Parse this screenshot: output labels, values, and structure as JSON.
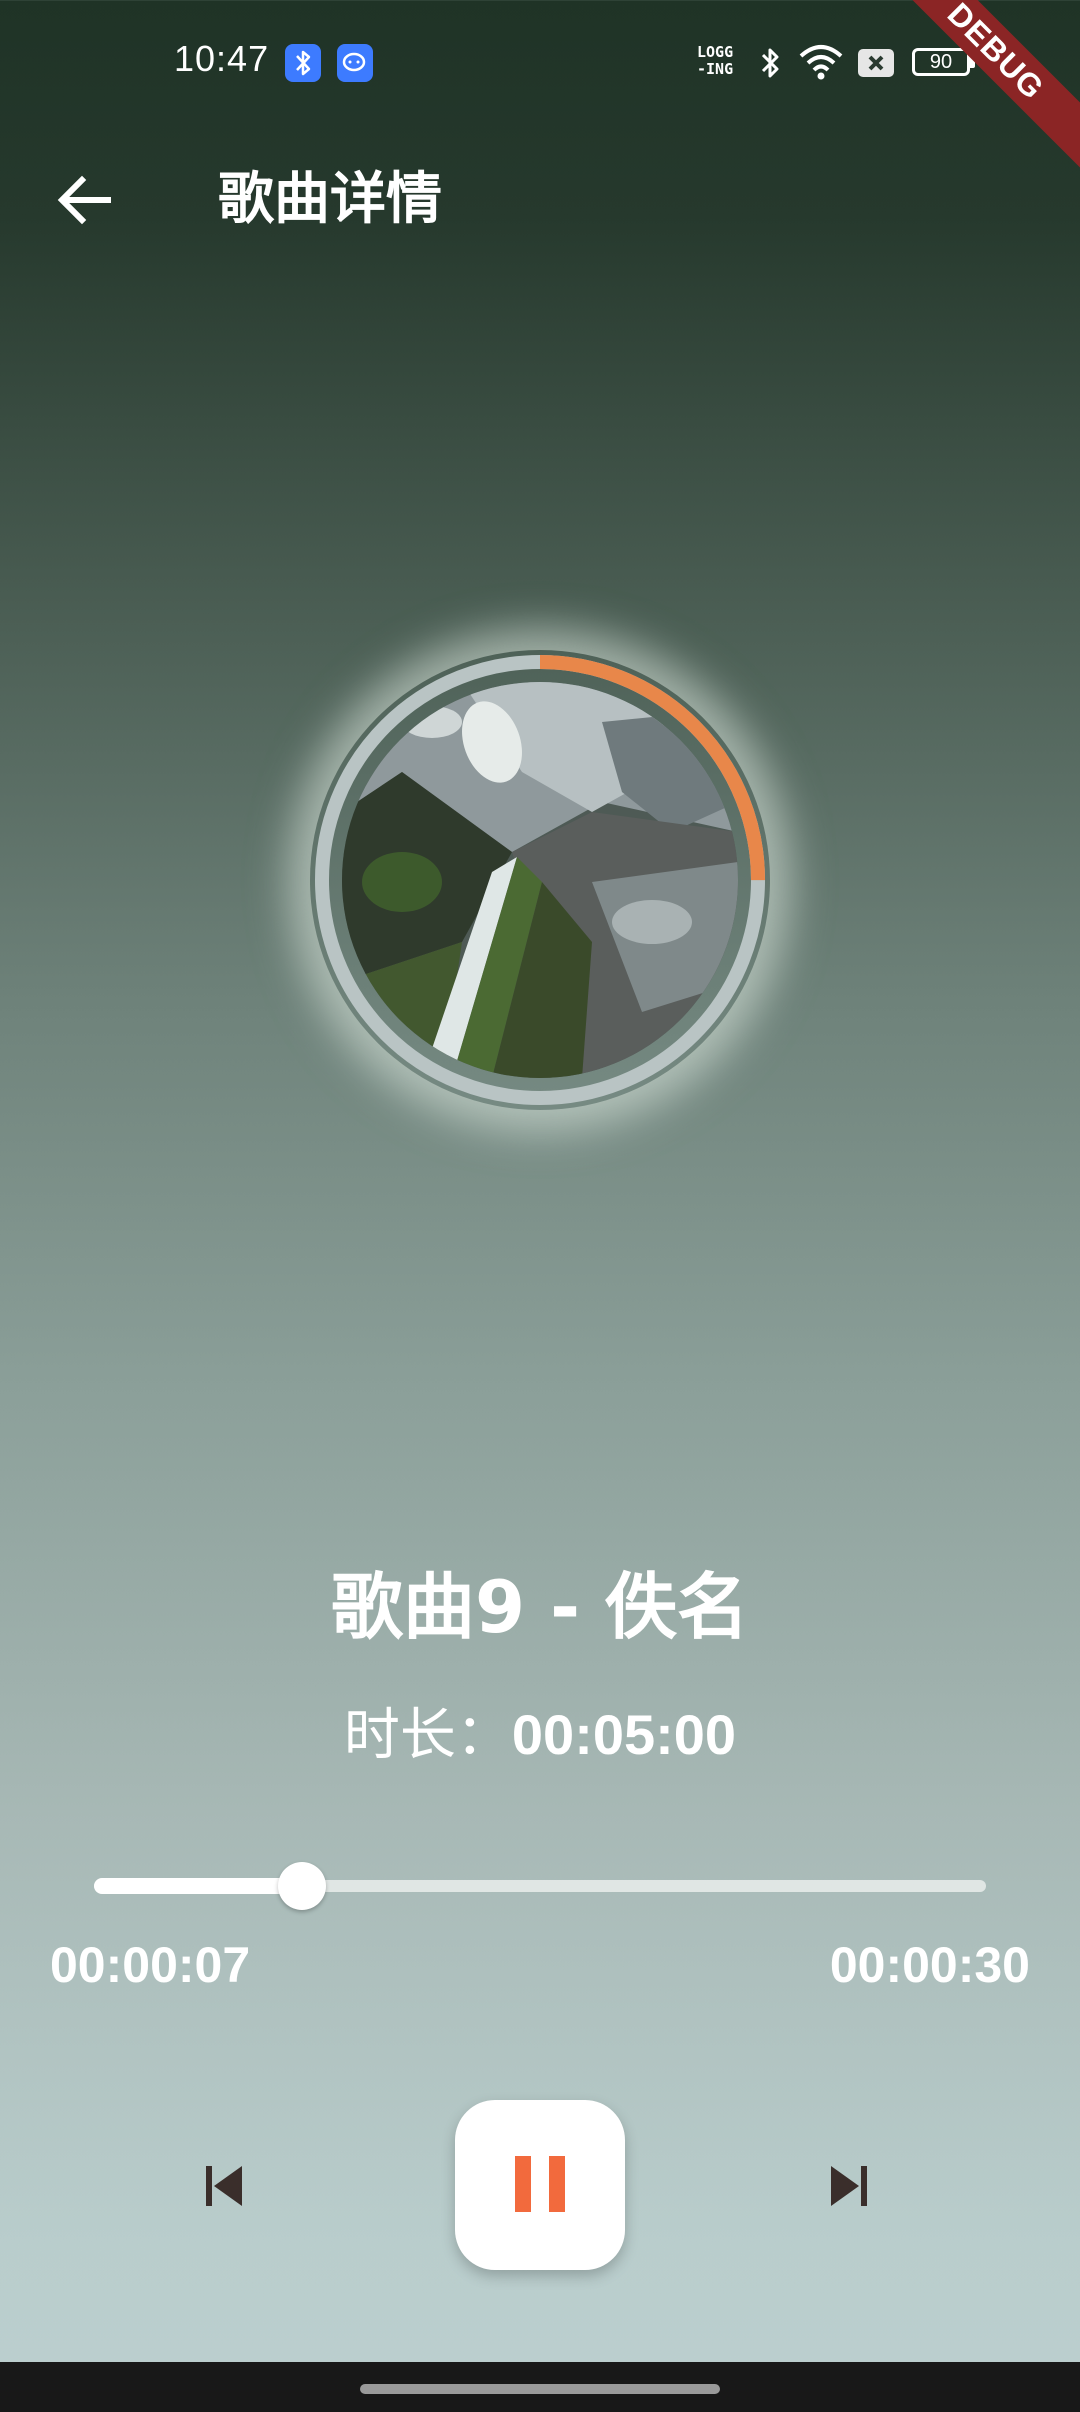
{
  "status_bar": {
    "time": "10:47",
    "logging_label": "LOGG\n-ING",
    "battery_level": "90",
    "icons": [
      "bluetooth-app-icon",
      "chat-app-icon",
      "bluetooth-icon",
      "wifi-icon",
      "sim-blocked-icon",
      "battery-icon"
    ]
  },
  "debug_banner": {
    "label": "DEBUG",
    "color": "#8b2525"
  },
  "app_bar": {
    "back_icon": "arrow-left-icon",
    "title": "歌曲详情"
  },
  "disc": {
    "progress_fraction": 0.25,
    "progress_color": "#e8874a",
    "track_color": "#b9c4c4"
  },
  "song": {
    "title": "歌曲9 - 佚名",
    "duration_label": "时长：",
    "duration_value": "00:05:00"
  },
  "player": {
    "position": "00:00:07",
    "total": "00:00:30",
    "slider_fraction": 0.233,
    "prev_icon": "skip-previous-icon",
    "next_icon": "skip-next-icon",
    "pause_icon": "pause-icon",
    "accent_color": "#f26a3d"
  }
}
